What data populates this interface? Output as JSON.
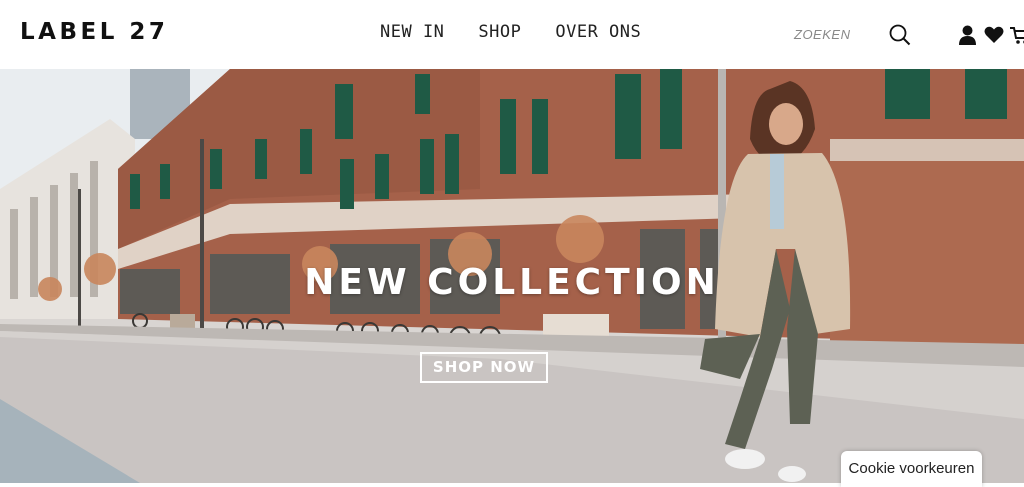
{
  "header": {
    "logo": "LABEL 27",
    "nav": [
      {
        "label": "NEW IN"
      },
      {
        "label": "SHOP"
      },
      {
        "label": "OVER ONS"
      }
    ],
    "search_label": "ZOEKEN",
    "icons": [
      "search-icon",
      "user-icon",
      "heart-icon",
      "cart-icon"
    ]
  },
  "hero": {
    "title": "NEW COLLECTION",
    "cta_label": "SHOP NOW"
  },
  "cookie_button": "Cookie voorkeuren",
  "colors": {
    "brick": "#a5614a",
    "window": "#1f5a45",
    "sky": "#e9edf0",
    "street": "#c9c4c2"
  }
}
